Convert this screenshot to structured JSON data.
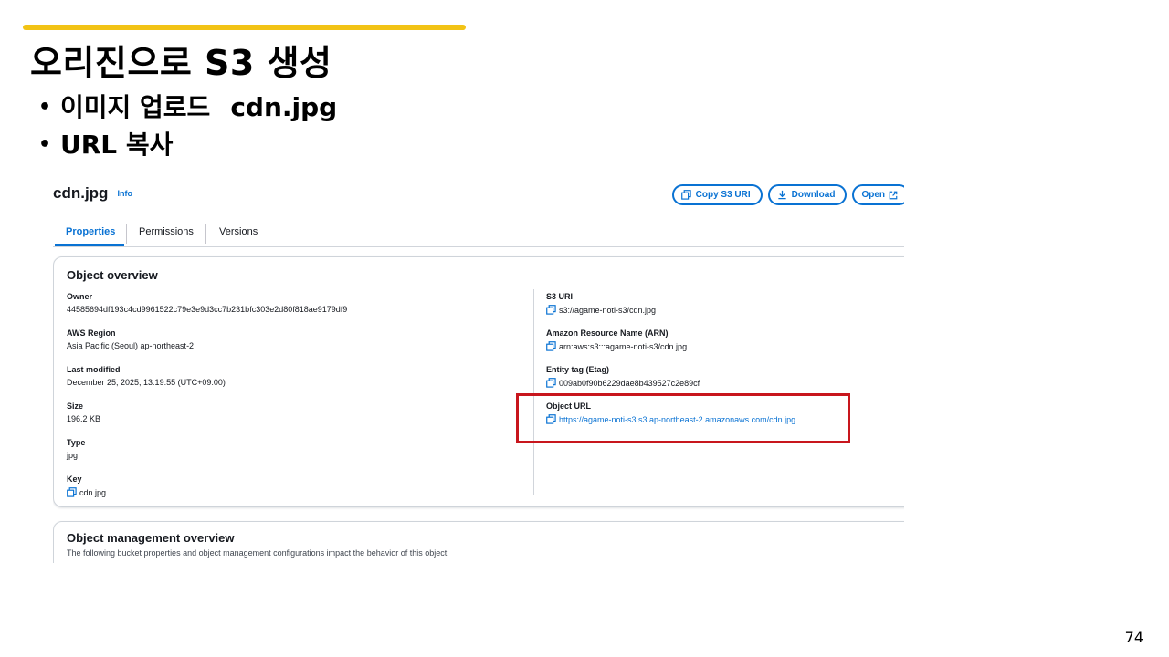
{
  "slide": {
    "title": "오리진으로 S3 생성",
    "bullets": [
      {
        "text": "이미지 업로드",
        "extra": "cdn.jpg"
      },
      {
        "text": "URL 복사",
        "extra": ""
      }
    ],
    "page_number": "74",
    "accent_color": "#f2c315",
    "highlight_color": "#c8161d"
  },
  "console": {
    "object_name": "cdn.jpg",
    "info_link": "Info",
    "buttons": {
      "copy_s3_uri": "Copy S3 URI",
      "download": "Download",
      "open": "Open"
    },
    "tabs": [
      {
        "label": "Properties",
        "active": true
      },
      {
        "label": "Permissions",
        "active": false
      },
      {
        "label": "Versions",
        "active": false
      }
    ],
    "overview": {
      "title": "Object overview",
      "owner": {
        "label": "Owner",
        "value": "44585694df193c4cd9961522c79e3e9d3cc7b231bfc303e2d80f818ae9179df9"
      },
      "region": {
        "label": "AWS Region",
        "value": "Asia Pacific (Seoul) ap-northeast-2"
      },
      "last_modified": {
        "label": "Last modified",
        "value": "December 25, 2025, 13:19:55 (UTC+09:00)"
      },
      "size": {
        "label": "Size",
        "value": "196.2 KB"
      },
      "type": {
        "label": "Type",
        "value": "jpg"
      },
      "key": {
        "label": "Key",
        "value": "cdn.jpg"
      },
      "s3_uri": {
        "label": "S3 URI",
        "value": "s3://agame-noti-s3/cdn.jpg"
      },
      "arn": {
        "label": "Amazon Resource Name (ARN)",
        "value": "arn:aws:s3:::agame-noti-s3/cdn.jpg"
      },
      "etag": {
        "label": "Entity tag (Etag)",
        "value": "009ab0f90b6229dae8b439527c2e89cf"
      },
      "object_url": {
        "label": "Object URL",
        "value": "https://agame-noti-s3.s3.ap-northeast-2.amazonaws.com/cdn.jpg"
      }
    },
    "management": {
      "title": "Object management overview",
      "description": "The following bucket properties and object management configurations impact the behavior of this object."
    },
    "link_color": "#0972d3"
  }
}
